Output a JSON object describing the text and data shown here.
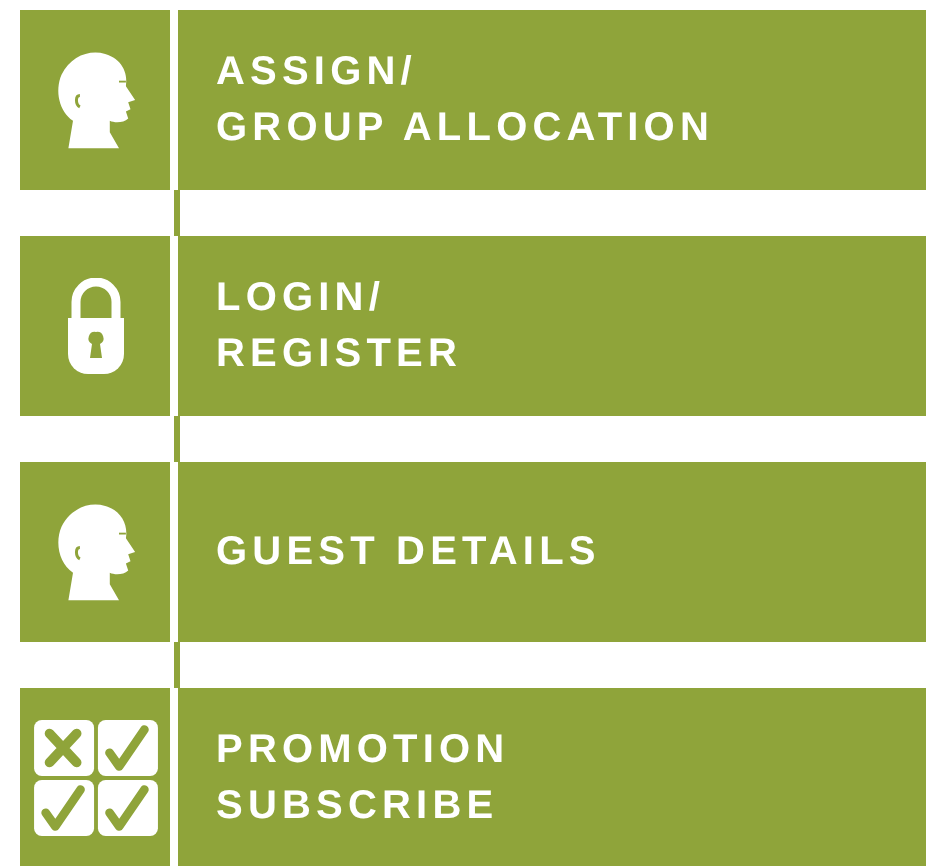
{
  "menu": [
    {
      "kind": "head",
      "label": "ASSIGN/\nGROUP ALLOCATION"
    },
    {
      "kind": "lock",
      "label": "LOGIN/\nREGISTER"
    },
    {
      "kind": "head",
      "label": "GUEST DETAILS"
    },
    {
      "kind": "checklist",
      "label": "PROMOTION\nSUBSCRIBE"
    }
  ]
}
